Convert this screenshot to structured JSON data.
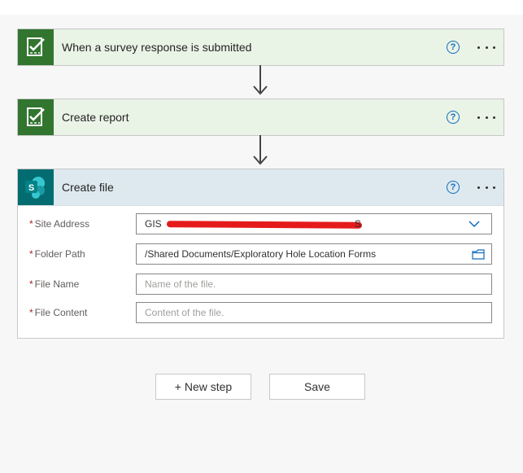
{
  "steps": [
    {
      "title": "When a survey response is submitted",
      "icon": "survey-icon"
    },
    {
      "title": "Create report",
      "icon": "survey-icon"
    },
    {
      "title": "Create file",
      "icon": "sharepoint-icon"
    }
  ],
  "help_glyph": "?",
  "sharepoint_letter": "S",
  "create_file": {
    "fields": [
      {
        "label": "Site Address",
        "required": "*",
        "value_prefix": "GIS",
        "value_suffix": "S",
        "redacted": true
      },
      {
        "label": "Folder Path",
        "required": "*",
        "value": "/Shared Documents/Exploratory Hole Location Forms"
      },
      {
        "label": "File Name",
        "required": "*",
        "placeholder": "Name of the file."
      },
      {
        "label": "File Content",
        "required": "*",
        "placeholder": "Content of the file."
      }
    ]
  },
  "buttons": {
    "new_step": "+ New step",
    "save": "Save"
  },
  "colors": {
    "survey_tile": "#31752f",
    "sharepoint_tile": "#036c70",
    "trigger_header": "#e9f3e6",
    "file_header": "#dde9ee",
    "link_blue": "#0f6cbd",
    "required": "#a4262c"
  }
}
